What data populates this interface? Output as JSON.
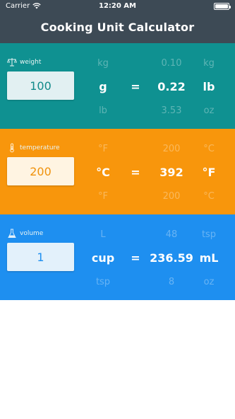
{
  "status_bar": {
    "carrier": "Carrier",
    "time": "12:20 AM"
  },
  "app": {
    "title": "Cooking Unit Calculator"
  },
  "colors": {
    "header": "#3d4a55",
    "weight": "#0f9191",
    "temperature": "#f8960c",
    "volume": "#1e8ff0"
  },
  "weight": {
    "label": "weight",
    "icon": "scale-icon",
    "input_value": "100",
    "from_prev": "kg",
    "from_unit": "g",
    "from_next": "lb",
    "result_prev": "0.10",
    "result": "0.22",
    "result_next": "3.53",
    "to_prev": "kg",
    "to_unit": "lb",
    "to_next": "oz",
    "equals": "="
  },
  "temperature": {
    "label": "temperature",
    "icon": "thermometer-icon",
    "input_value": "200",
    "from_prev": "°F",
    "from_unit": "°C",
    "from_next": "°F",
    "result_prev": "200",
    "result": "392",
    "result_next": "200",
    "to_prev": "°C",
    "to_unit": "°F",
    "to_next": "°C",
    "equals": "="
  },
  "volume": {
    "label": "volume",
    "icon": "flask-icon",
    "input_value": "1",
    "from_prev": "L",
    "from_unit": "cup",
    "from_next": "tsp",
    "result_prev": "48",
    "result": "236.59",
    "result_next": "8",
    "to_prev": "tsp",
    "to_unit": "mL",
    "to_next": "oz",
    "equals": "="
  }
}
